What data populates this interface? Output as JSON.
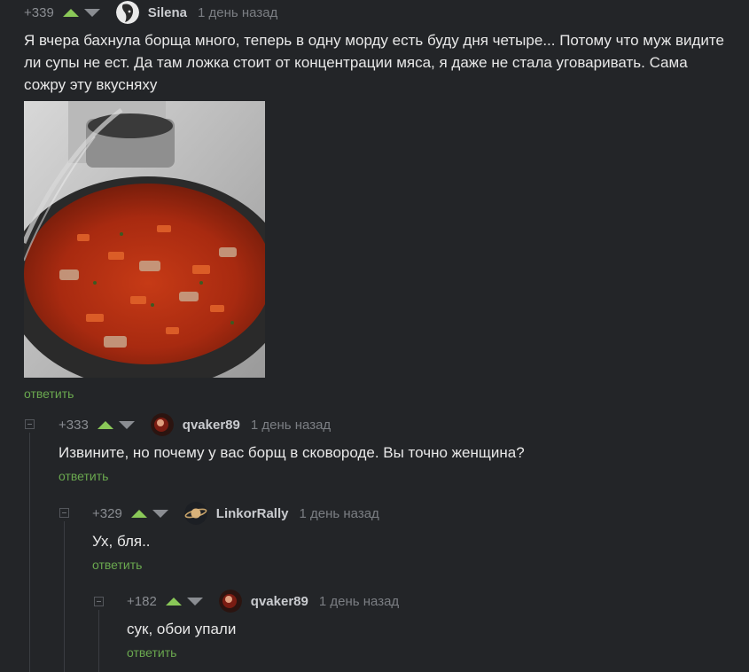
{
  "comments": [
    {
      "rating": "+339",
      "author": "Silena",
      "time": "1 день назад",
      "text": "Я вчера бахнула борща много, теперь в одну морду есть буду дня четыре... Потому что муж видите ли супы не ест. Да там ложка стоит от концентрации мяса, я даже не стала уговаривать. Сама сожру эту вкусняху",
      "reply": "ответить"
    },
    {
      "rating": "+333",
      "author": "qvaker89",
      "time": "1 день назад",
      "text": "Извините, но почему у вас борщ в сковороде. Вы точно женщина?",
      "reply": "ответить"
    },
    {
      "rating": "+329",
      "author": "LinkorRally",
      "time": "1 день назад",
      "text": "Ух, бля..",
      "reply": "ответить"
    },
    {
      "rating": "+182",
      "author": "qvaker89",
      "time": "1 день назад",
      "text": "сук, обои упали",
      "reply": "ответить"
    }
  ],
  "colors": {
    "background": "#232528",
    "upvote": "#8ac858",
    "reply_link": "#6aa84f"
  },
  "icons": [
    "upvote-arrow-icon",
    "downvote-arrow-icon",
    "collapse-thread-icon"
  ]
}
